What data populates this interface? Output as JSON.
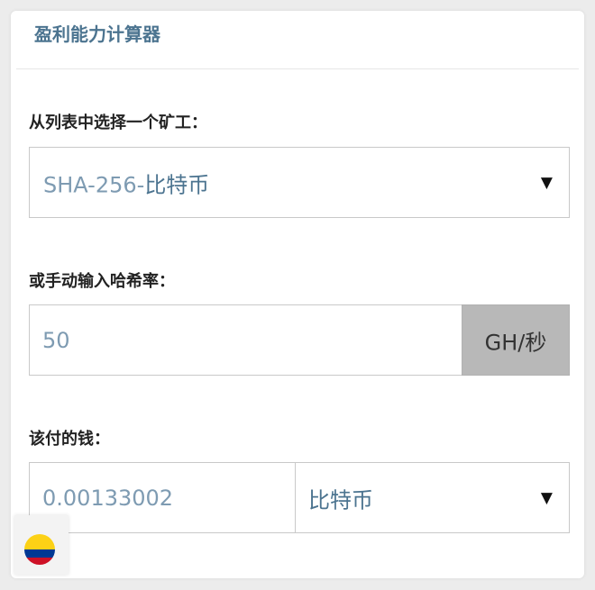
{
  "widget": {
    "title": "盈利能力计算器"
  },
  "miner_select": {
    "label": "从列表中选择一个矿工：",
    "value_prefix": "SHA-256-",
    "value_main": "比特币",
    "caret": "▼"
  },
  "hashrate": {
    "label": "或手动输入哈希率：",
    "value": "50",
    "unit_prefix": "GH/",
    "unit_main": "秒"
  },
  "payout": {
    "label": "该付的钱：",
    "amount": "0.00133002",
    "currency": "比特币",
    "caret": "▼"
  },
  "language_button": {
    "icon": "colombia-flag-icon",
    "colors": {
      "yellow": "#fcd116",
      "blue": "#003893",
      "red": "#ce1126"
    }
  }
}
